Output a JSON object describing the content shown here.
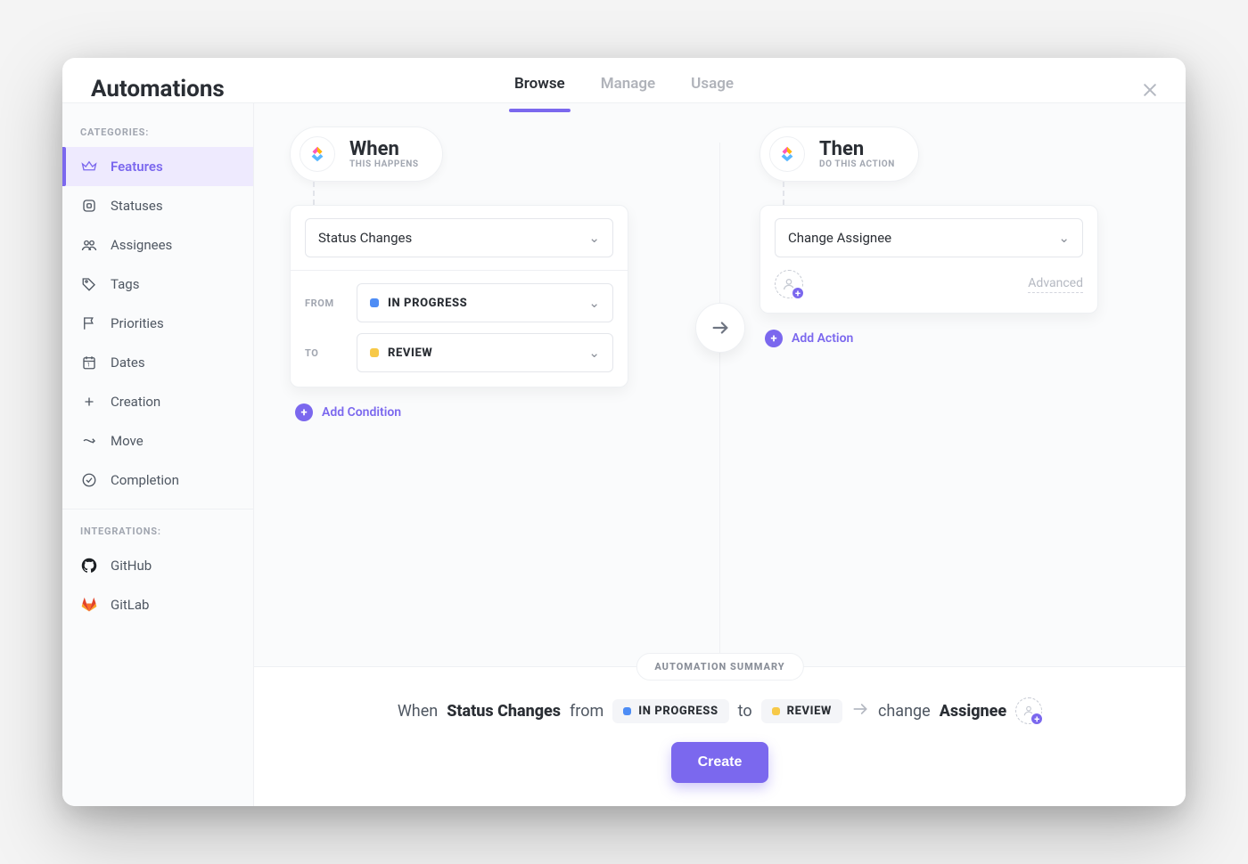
{
  "header": {
    "title": "Automations",
    "tabs": [
      {
        "label": "Browse",
        "active": true
      },
      {
        "label": "Manage",
        "active": false
      },
      {
        "label": "Usage",
        "active": false
      }
    ]
  },
  "sidebar": {
    "categories_heading": "CATEGORIES:",
    "integrations_heading": "INTEGRATIONS:",
    "categories": [
      {
        "label": "Features",
        "icon": "crown",
        "active": true
      },
      {
        "label": "Statuses",
        "icon": "status",
        "active": false
      },
      {
        "label": "Assignees",
        "icon": "people",
        "active": false
      },
      {
        "label": "Tags",
        "icon": "tag",
        "active": false
      },
      {
        "label": "Priorities",
        "icon": "flag",
        "active": false
      },
      {
        "label": "Dates",
        "icon": "calendar",
        "active": false
      },
      {
        "label": "Creation",
        "icon": "plus",
        "active": false
      },
      {
        "label": "Move",
        "icon": "move",
        "active": false
      },
      {
        "label": "Completion",
        "icon": "check",
        "active": false
      }
    ],
    "integrations": [
      {
        "label": "GitHub",
        "icon": "github"
      },
      {
        "label": "GitLab",
        "icon": "gitlab"
      }
    ]
  },
  "when": {
    "title": "When",
    "subtitle": "THIS HAPPENS",
    "trigger": "Status Changes",
    "from_label": "FROM",
    "to_label": "TO",
    "from_status": {
      "label": "IN PROGRESS",
      "color": "#4e8df5"
    },
    "to_status": {
      "label": "REVIEW",
      "color": "#f7c948"
    },
    "add_condition": "Add Condition"
  },
  "then": {
    "title": "Then",
    "subtitle": "DO THIS ACTION",
    "action": "Change Assignee",
    "advanced": "Advanced",
    "add_action": "Add Action"
  },
  "summary": {
    "badge": "AUTOMATION SUMMARY",
    "when_word": "When",
    "trigger": "Status Changes",
    "from_word": "from",
    "from_status": {
      "label": "IN PROGRESS",
      "color": "#4e8df5"
    },
    "to_word": "to",
    "to_status": {
      "label": "REVIEW",
      "color": "#f7c948"
    },
    "change_word": "change",
    "target": "Assignee",
    "create": "Create"
  }
}
